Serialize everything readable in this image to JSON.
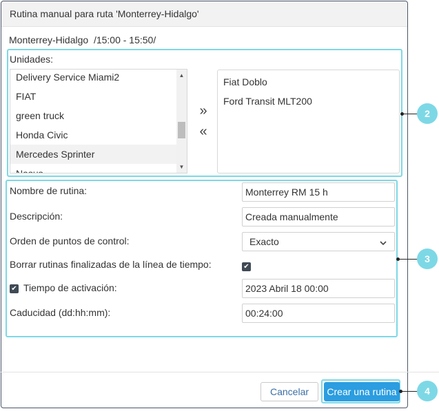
{
  "dialog": {
    "title": "Rutina manual para ruta 'Monterrey-Hidalgo'",
    "route_info": "Monterrey-Hidalgo  /15:00 - 15:50/"
  },
  "units": {
    "label": "Unidades:",
    "available": [
      "Delivery Service Miami2",
      "FIAT",
      "green truck",
      "Honda Civic",
      "Mercedes Sprinter",
      "Nasus"
    ],
    "selected_index": 4,
    "add_glyph": "»",
    "remove_glyph": "«",
    "chosen": [
      "Fiat Doblo",
      "Ford Transit MLT200"
    ]
  },
  "form": {
    "name_label": "Nombre de rutina:",
    "name_value": "Monterrey RM 15 h",
    "description_label": "Descripción:",
    "description_value": "Creada manualmente",
    "order_label": "Orden de puntos de control:",
    "order_value": "Exacto",
    "delete_label": "Borrar rutinas finalizadas de la línea de tiempo:",
    "delete_checked": true,
    "activation_label": "Tiempo de activación:",
    "activation_checked": true,
    "activation_value": "2023 Abril 18 00:00",
    "expiration_label": "Caducidad (dd:hh:mm):",
    "expiration_value": "00:24:00"
  },
  "footer": {
    "cancel_label": "Cancelar",
    "create_label": "Crear una rutina"
  },
  "callouts": [
    "2",
    "3",
    "4"
  ],
  "colors": {
    "highlight": "#7dd8e6",
    "primary_button": "#2b9de0",
    "checkbox": "#3f4a55"
  }
}
